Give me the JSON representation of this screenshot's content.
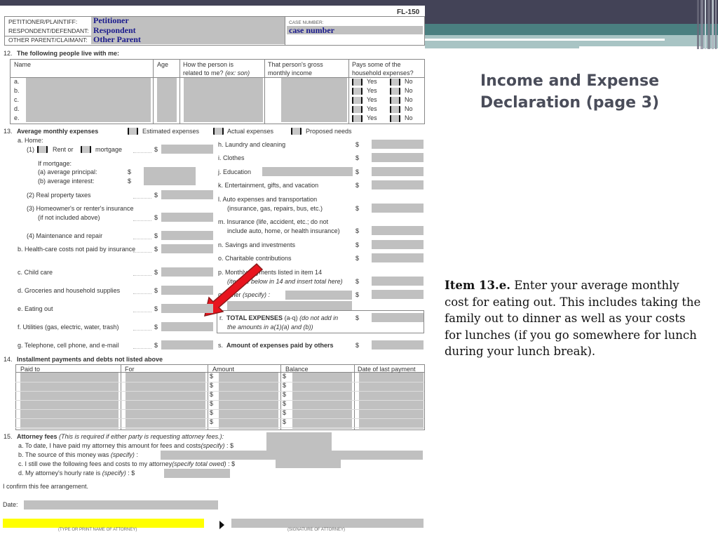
{
  "slide": {
    "title_line1": "Income and Expense",
    "title_line2": "Declaration (page 3)",
    "note_bold": "Item 13.e.",
    "note_text": "  Enter your average monthly cost for eating out.  This includes taking the family out to dinner as well as your costs for lunches (if you go somewhere for lunch during your lunch break).",
    "colors": {
      "top_band": "#434357",
      "teal": "#4a7f80",
      "pale_teal": "#a8c4c4",
      "arrow": "#e8141e",
      "highlight": "#ffff00",
      "field_fill": "#c0c0c0",
      "form_text_blue": "#1a1a8c"
    }
  },
  "form": {
    "form_number": "FL-150",
    "header": {
      "petitioner_label": "PETITIONER/PLAINTIFF:",
      "petitioner_value": "Petitioner",
      "respondent_label": "RESPONDENT/DEFENDANT:",
      "respondent_value": "Respondent",
      "other_label": "OTHER PARENT/CLAIMANT:",
      "other_value": "Other Parent",
      "case_number_label": "CASE NUMBER:",
      "case_number_value": "case number"
    },
    "s12": {
      "number": "12.",
      "title": "The following people live with me:",
      "col_name": "Name",
      "col_age": "Age",
      "col_relation_1": "How the person is",
      "col_relation_2": "related to me?",
      "col_relation_example": "(ex: son)",
      "col_income_1": "That person's gross",
      "col_income_2": "monthly income",
      "col_pays_1": "Pays some of the",
      "col_pays_2": "household expenses?",
      "rows": [
        "a.",
        "b.",
        "c.",
        "d.",
        "e."
      ],
      "yes": "Yes",
      "no": "No"
    },
    "s13": {
      "number": "13.",
      "title": "Average monthly expenses",
      "opt_estimated": "Estimated expenses",
      "opt_actual": "Actual expenses",
      "opt_proposed": "Proposed needs",
      "a_home": "a.  Home:",
      "a1_prefix": "(1)",
      "a1_rent": "Rent or",
      "a1_mortgage": "mortgage",
      "if_mortgage": "If mortgage:",
      "a1a": "(a)   average principal:",
      "a1b": "(b)   average interest:",
      "a2": "(2)  Real property taxes",
      "a3_1": "(3)  Homeowner's or renter's insurance",
      "a3_2": "(if not included above)",
      "a4": "(4)  Maintenance and repair",
      "b": "b.  Health-care costs not paid by insurance",
      "c": "c.  Child care",
      "d": "d.  Groceries and household supplies",
      "e": "e.  Eating out",
      "f": "f.   Utilities (gas, electric, water, trash)",
      "g": "g.  Telephone, cell phone, and e-mail",
      "h": "h.  Laundry and cleaning",
      "i": "i.   Clothes",
      "j": "j.   Education",
      "k": "k.  Entertainment, gifts, and vacation",
      "l_1": "l.   Auto expenses and transportation",
      "l_2": "(insurance, gas, repairs, bus, etc.)",
      "m_1": "m. Insurance (life, accident, etc.; do not",
      "m_2": "include auto, home, or health insurance)",
      "n": "n.  Savings and investments",
      "o": "o.  Charitable contributions",
      "p_1": "p.  Monthly payments listed in item 14",
      "p_2": "(itemize below in 14 and insert total here)",
      "q": "q.  Other",
      "q_specify": "(specify) :",
      "r_letter": "r.",
      "r_bold": "TOTAL EXPENSES",
      "r_range": "(a-q)",
      "r_italic_1": "(do not add in",
      "r_italic_2": "the amounts in a(1)(a) and (b))",
      "s_letter": "s.",
      "s_bold": "Amount of expenses paid by others",
      "dollar": "$"
    },
    "s14": {
      "number": "14.",
      "title": "Installment payments and debts not listed above",
      "col_paid_to": "Paid to",
      "col_for": "For",
      "col_amount": "Amount",
      "col_balance": "Balance",
      "col_date": "Date of last payment",
      "row_count": 6,
      "dollar": "$"
    },
    "s15": {
      "number": "15.",
      "title": "Attorney fees",
      "note": "(This is required if either party is requesting attorney fees.):",
      "a": "a.   To date, I have paid my attorney this amount for fees and costs",
      "a_spec": "(specify)",
      "a_end": " : $",
      "b": "b.   The source of this money was",
      "b_spec": "(specify)",
      "b_end": " :",
      "c": "c.   I still owe the following fees and costs to my attorney",
      "c_spec": "(specify total owed)",
      "c_end": " : $",
      "d": "d.   My attorney's hourly rate is",
      "d_spec": "(specify)",
      "d_end": " : $",
      "confirm": "I confirm this fee arrangement.",
      "date_label": "Date:",
      "name_caption": "(TYPE OR PRINT NAME OF ATTORNEY)",
      "signature_caption": "(SIGNATURE OF ATTORNEY)"
    }
  }
}
